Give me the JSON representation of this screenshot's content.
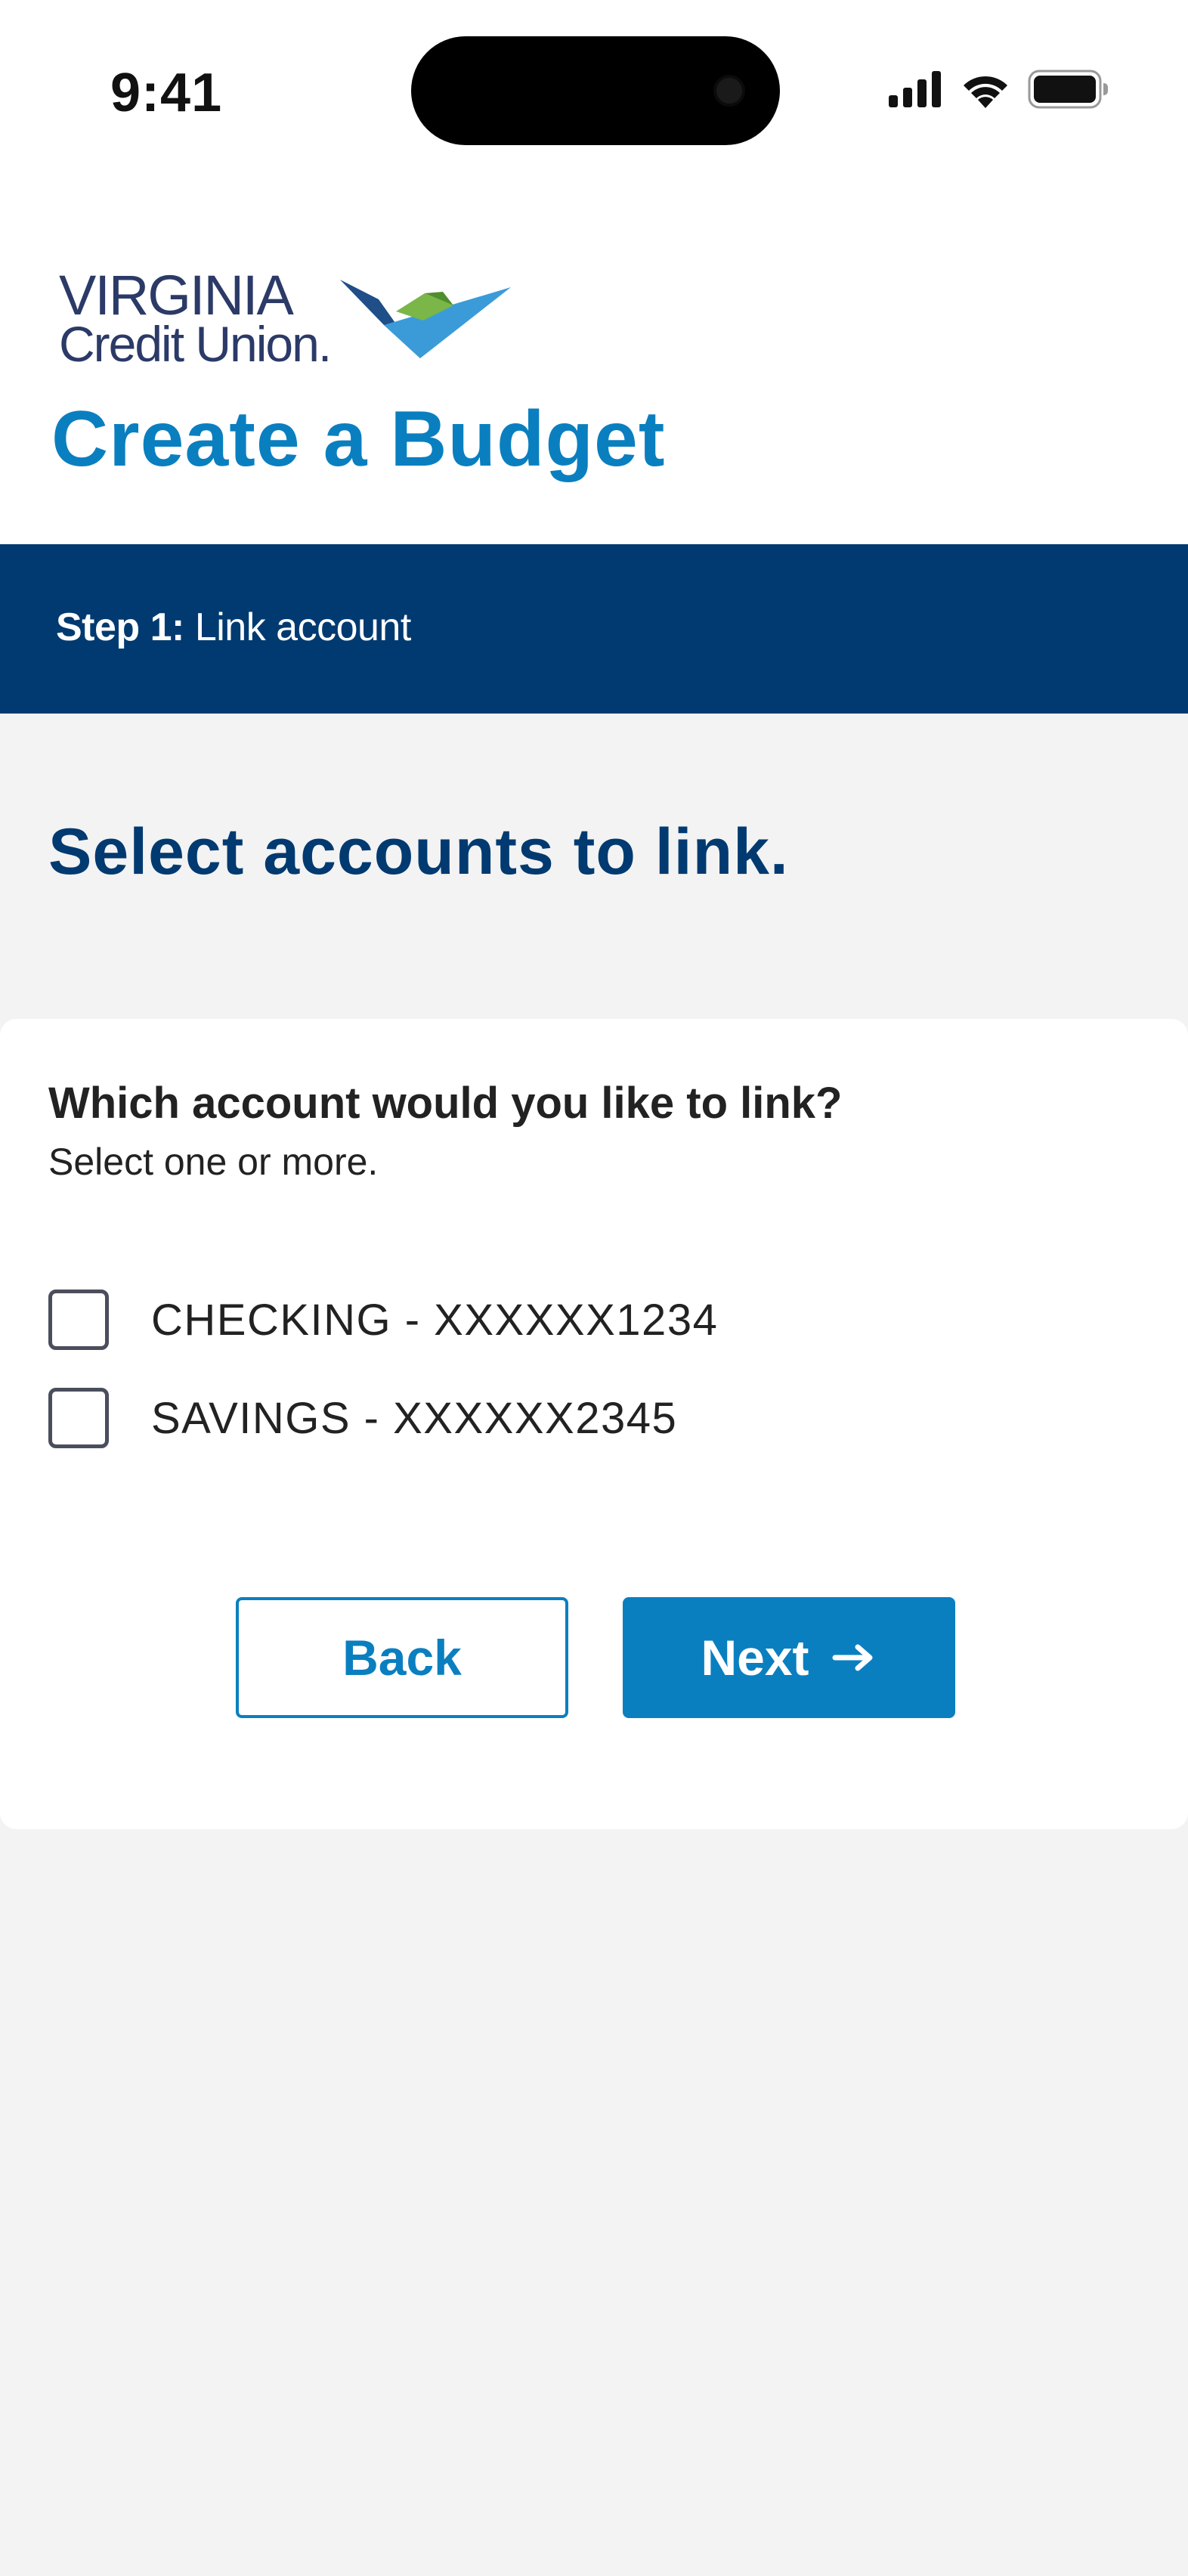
{
  "status_bar": {
    "time": "9:41"
  },
  "header": {
    "logo_line1": "VIRGINIA",
    "logo_line2": "Credit Union.",
    "title": "Create a Budget"
  },
  "step": {
    "label": "Step 1:",
    "text": " Link account"
  },
  "section": {
    "heading": "Select accounts to link."
  },
  "card": {
    "question": "Which account would you like to link?",
    "helper": "Select one or more.",
    "options": [
      {
        "label": "CHECKING - XXXXXX1234",
        "checked": false
      },
      {
        "label": "SAVINGS - XXXXXX2345",
        "checked": false
      }
    ]
  },
  "buttons": {
    "back_label": "Back",
    "next_label": "Next"
  },
  "colors": {
    "brand_blue": "#0a7fc0",
    "navy": "#003a70",
    "logo_green": "#7ab648",
    "background": "#f3f3f3"
  },
  "icons": {
    "cellular": "cellular-signal-icon",
    "wifi": "wifi-icon",
    "battery": "battery-icon",
    "next_arrow": "arrow-right-icon"
  }
}
